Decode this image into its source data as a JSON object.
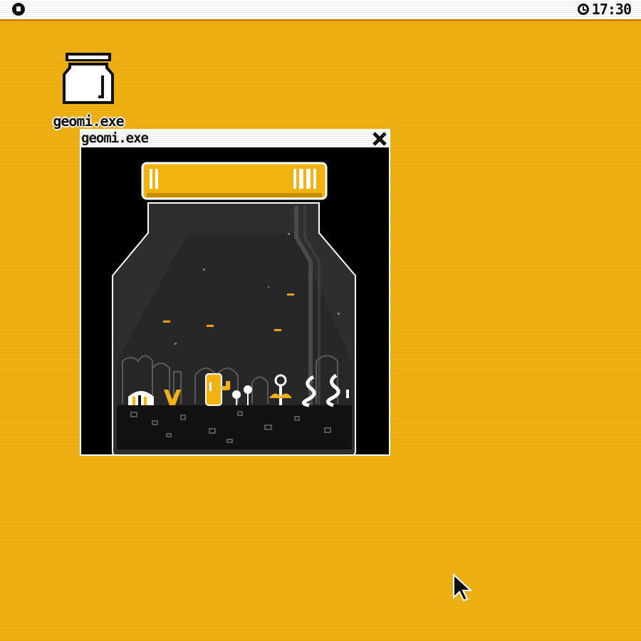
{
  "menubar": {
    "logo_icon": "system-menu-icon",
    "clock_icon": "clock-icon",
    "time": "17:30"
  },
  "desktop": {
    "icons": [
      {
        "label": "geomi.exe",
        "icon": "jar-icon"
      }
    ]
  },
  "window": {
    "title": "geomi.exe",
    "close_icon": "close-icon",
    "content": "jar-terrarium-scene"
  },
  "colors": {
    "desktop": "#f0b010",
    "menubar": "#ffffff",
    "accent": "#f2b30f",
    "window_bg": "#000000"
  },
  "cursor": "arrow-cursor-icon"
}
